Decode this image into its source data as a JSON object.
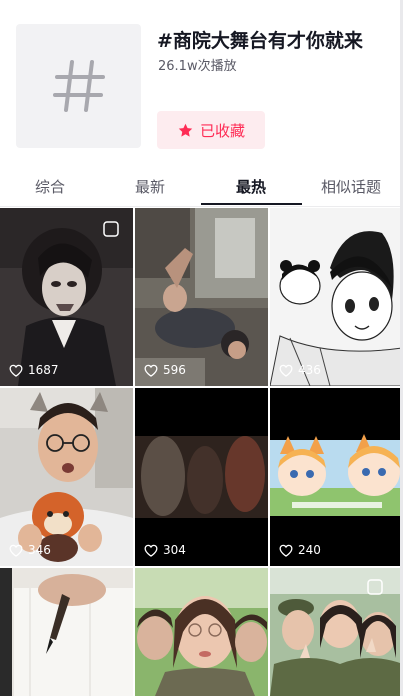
{
  "topic": {
    "title": "#商院大舞台有才你就来",
    "play_count": "26.1w次播放",
    "cover_icon": "hashtag-icon"
  },
  "collect_button": {
    "label": "已收藏",
    "icon": "star-icon",
    "color": "#fe2c55",
    "background": "#fdecef"
  },
  "tabs": [
    {
      "label": "综合",
      "active": false
    },
    {
      "label": "最新",
      "active": false
    },
    {
      "label": "最热",
      "active": true
    },
    {
      "label": "相似话题",
      "active": false
    }
  ],
  "videos": [
    {
      "likes": "1687",
      "description": "cosplay character with dark curly hair and face makeup"
    },
    {
      "likes": "596",
      "description": "person lying down in a classroom, dark photo"
    },
    {
      "likes": "436",
      "description": "black and white manga illustration of characters"
    },
    {
      "likes": "346",
      "description": "young man with glasses holding red panda plush"
    },
    {
      "likes": "304",
      "description": "dark blurry video frame"
    },
    {
      "likes": "240",
      "description": "anime girls with fox ears"
    },
    {
      "likes": "",
      "description": "hand holding a brush over white paper"
    },
    {
      "likes": "",
      "description": "women taking a selfie outdoors"
    },
    {
      "likes": "",
      "description": "students in camouflage uniforms making peace signs"
    }
  ]
}
